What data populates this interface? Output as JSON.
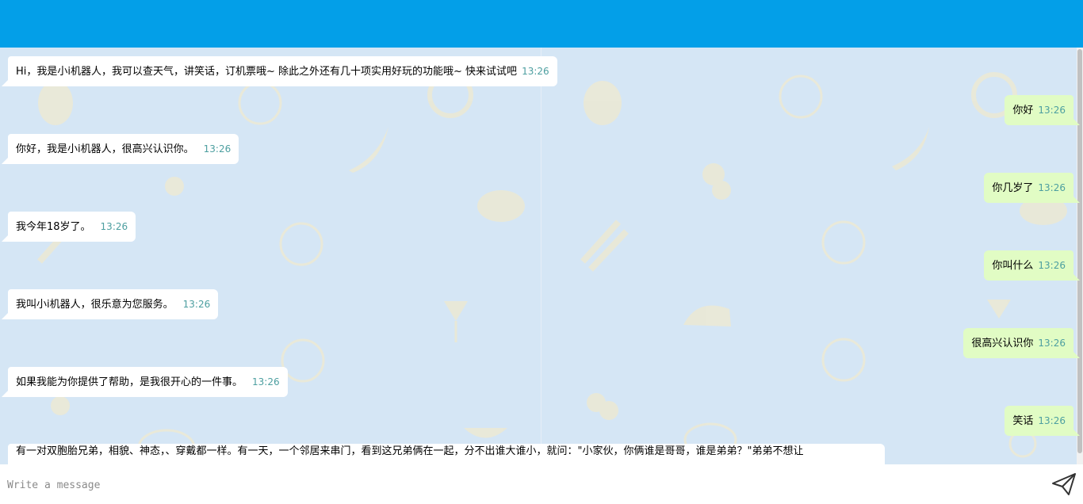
{
  "composer": {
    "placeholder": "Write a message",
    "send_icon": "send-paper-plane-icon"
  },
  "theme": {
    "header_color": "#039fe8",
    "chat_background": "#d5e6f5",
    "incoming_bubble": "#ffffff",
    "outgoing_bubble": "#e1fcc4",
    "timestamp_color": "#4d9fa0"
  },
  "messages": [
    {
      "side": "bot",
      "text": "Hi，我是小i机器人，我可以查天气，讲笑话，订机票哦~ 除此之外还有几十项实用好玩的功能哦~ 快来试试吧",
      "time": "13:26"
    },
    {
      "side": "user",
      "text": "你好",
      "time": "13:26"
    },
    {
      "side": "bot",
      "text": "你好，我是小i机器人，很高兴认识你。",
      "time": "13:26"
    },
    {
      "side": "user",
      "text": "你几岁了",
      "time": "13:26"
    },
    {
      "side": "bot",
      "text": "我今年18岁了。",
      "time": "13:26"
    },
    {
      "side": "user",
      "text": "你叫什么",
      "time": "13:26"
    },
    {
      "side": "bot",
      "text": "我叫小i机器人，很乐意为您服务。",
      "time": "13:26"
    },
    {
      "side": "user",
      "text": "很高兴认识你",
      "time": "13:26"
    },
    {
      "side": "bot",
      "text": "如果我能为你提供了帮助，是我很开心的一件事。",
      "time": "13:26"
    },
    {
      "side": "user",
      "text": "笑话",
      "time": "13:26"
    },
    {
      "side": "bot",
      "text": "有一对双胞胎兄弟，相貌、神态，、穿戴都一样。有一天，一个邻居来串门，看到这兄弟俩在一起，分不出谁大谁小，就问：\"小家伙，你俩谁是哥哥，谁是弟弟？\"弟弟不想让"
    }
  ]
}
